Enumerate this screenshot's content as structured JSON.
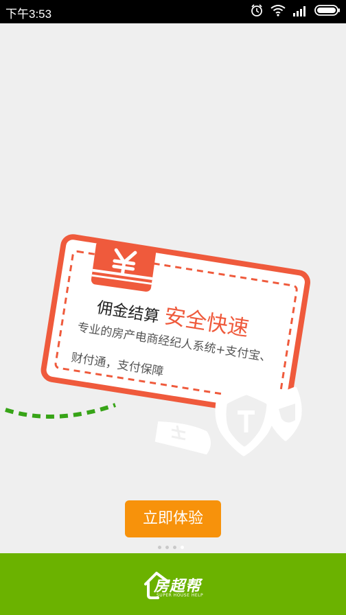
{
  "status_bar": {
    "time": "下午3:53",
    "icons": [
      "alarm-icon",
      "wifi-icon",
      "signal-icon",
      "battery-icon"
    ]
  },
  "card": {
    "title_black": "佣金结算",
    "title_red": "安全快速",
    "desc_line1": "专业的房产电商经纪人系统+支付宝、",
    "desc_line2": "财付通，支付保障"
  },
  "cta": {
    "label": "立即体验"
  },
  "pager": {
    "count": 4,
    "active_index": 3
  },
  "footer": {
    "logo_text": "房超帮",
    "logo_subtext": "SUPER HOUSE HELP"
  },
  "colors": {
    "accent_orange": "#f7920b",
    "footer_green": "#6bb200",
    "card_red": "#ef5a3c",
    "dash_green": "#37a417"
  }
}
